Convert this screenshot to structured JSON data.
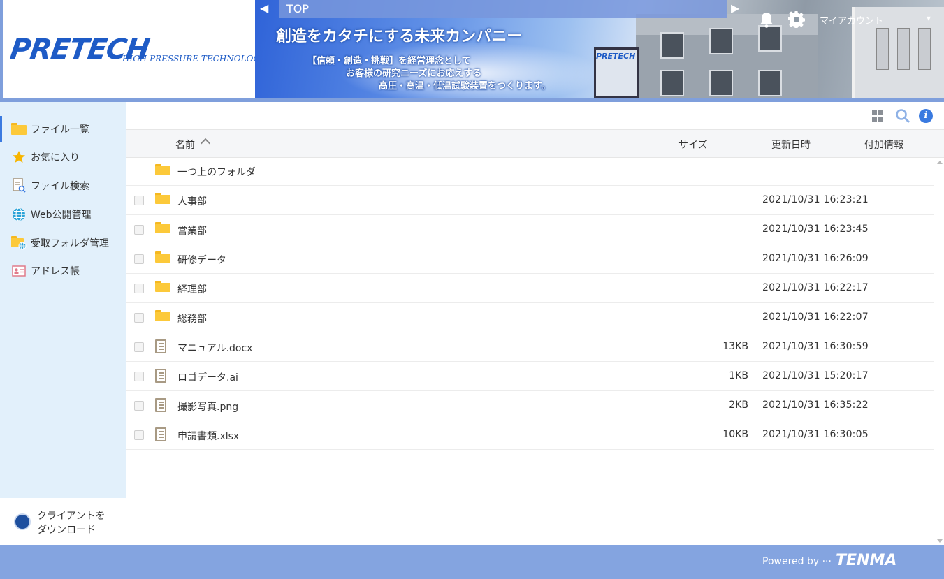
{
  "brand": {
    "logo_text": "PRETECH",
    "logo_subtitle": "HIGH PRESSURE TECHNOLOGY",
    "footer_powered": "Powered by ···",
    "footer_brand": "TENMA"
  },
  "banner": {
    "headline": "創造をカタチにする未来カンパニー",
    "line1": "【信頼・創造・挑戦】を経営理念として",
    "line2": "お客様の研究ニーズにお応えする",
    "line3": "高圧・高温・低温試験装置をつくります。",
    "sign_text": "PRETECH"
  },
  "header": {
    "tab_label": "TOP",
    "account_label": "マイアカウント",
    "icons": [
      "bell-icon",
      "gear-icon"
    ]
  },
  "sidebar": {
    "items": [
      {
        "label": "ファイル一覧",
        "icon": "folder-icon"
      },
      {
        "label": "お気に入り",
        "icon": "star-icon"
      },
      {
        "label": "ファイル検索",
        "icon": "file-search-icon"
      },
      {
        "label": "Web公開管理",
        "icon": "globe-icon"
      },
      {
        "label": "受取フォルダ管理",
        "icon": "folder-globe-icon"
      },
      {
        "label": "アドレス帳",
        "icon": "address-book-icon"
      }
    ],
    "download_line1": "クライアントを",
    "download_line2": "ダウンロード"
  },
  "table": {
    "columns": {
      "name": "名前",
      "size": "サイズ",
      "updated": "更新日時",
      "extra": "付加情報"
    },
    "parent_folder": "一つ上のフォルダ",
    "rows": [
      {
        "name": "人事部",
        "type": "folder",
        "size": "",
        "date": "2021/10/31 16:23:21"
      },
      {
        "name": "営業部",
        "type": "folder",
        "size": "",
        "date": "2021/10/31 16:23:45"
      },
      {
        "name": "研修データ",
        "type": "folder",
        "size": "",
        "date": "2021/10/31 16:26:09"
      },
      {
        "name": "経理部",
        "type": "folder",
        "size": "",
        "date": "2021/10/31 16:22:17"
      },
      {
        "name": "総務部",
        "type": "folder",
        "size": "",
        "date": "2021/10/31 16:22:07"
      },
      {
        "name": "マニュアル.docx",
        "type": "file",
        "size": "13KB",
        "date": "2021/10/31 16:30:59"
      },
      {
        "name": "ロゴデータ.ai",
        "type": "file",
        "size": "1KB",
        "date": "2021/10/31 15:20:17"
      },
      {
        "name": "撮影写真.png",
        "type": "file",
        "size": "2KB",
        "date": "2021/10/31 16:35:22"
      },
      {
        "name": "申請書類.xlsx",
        "type": "file",
        "size": "10KB",
        "date": "2021/10/31 16:30:05"
      }
    ]
  },
  "colors": {
    "accent": "#3a7ae0",
    "header_bg": "#7f9fdc",
    "sidebar_bg": "#e2f0fb",
    "folder": "#fcc93a"
  }
}
